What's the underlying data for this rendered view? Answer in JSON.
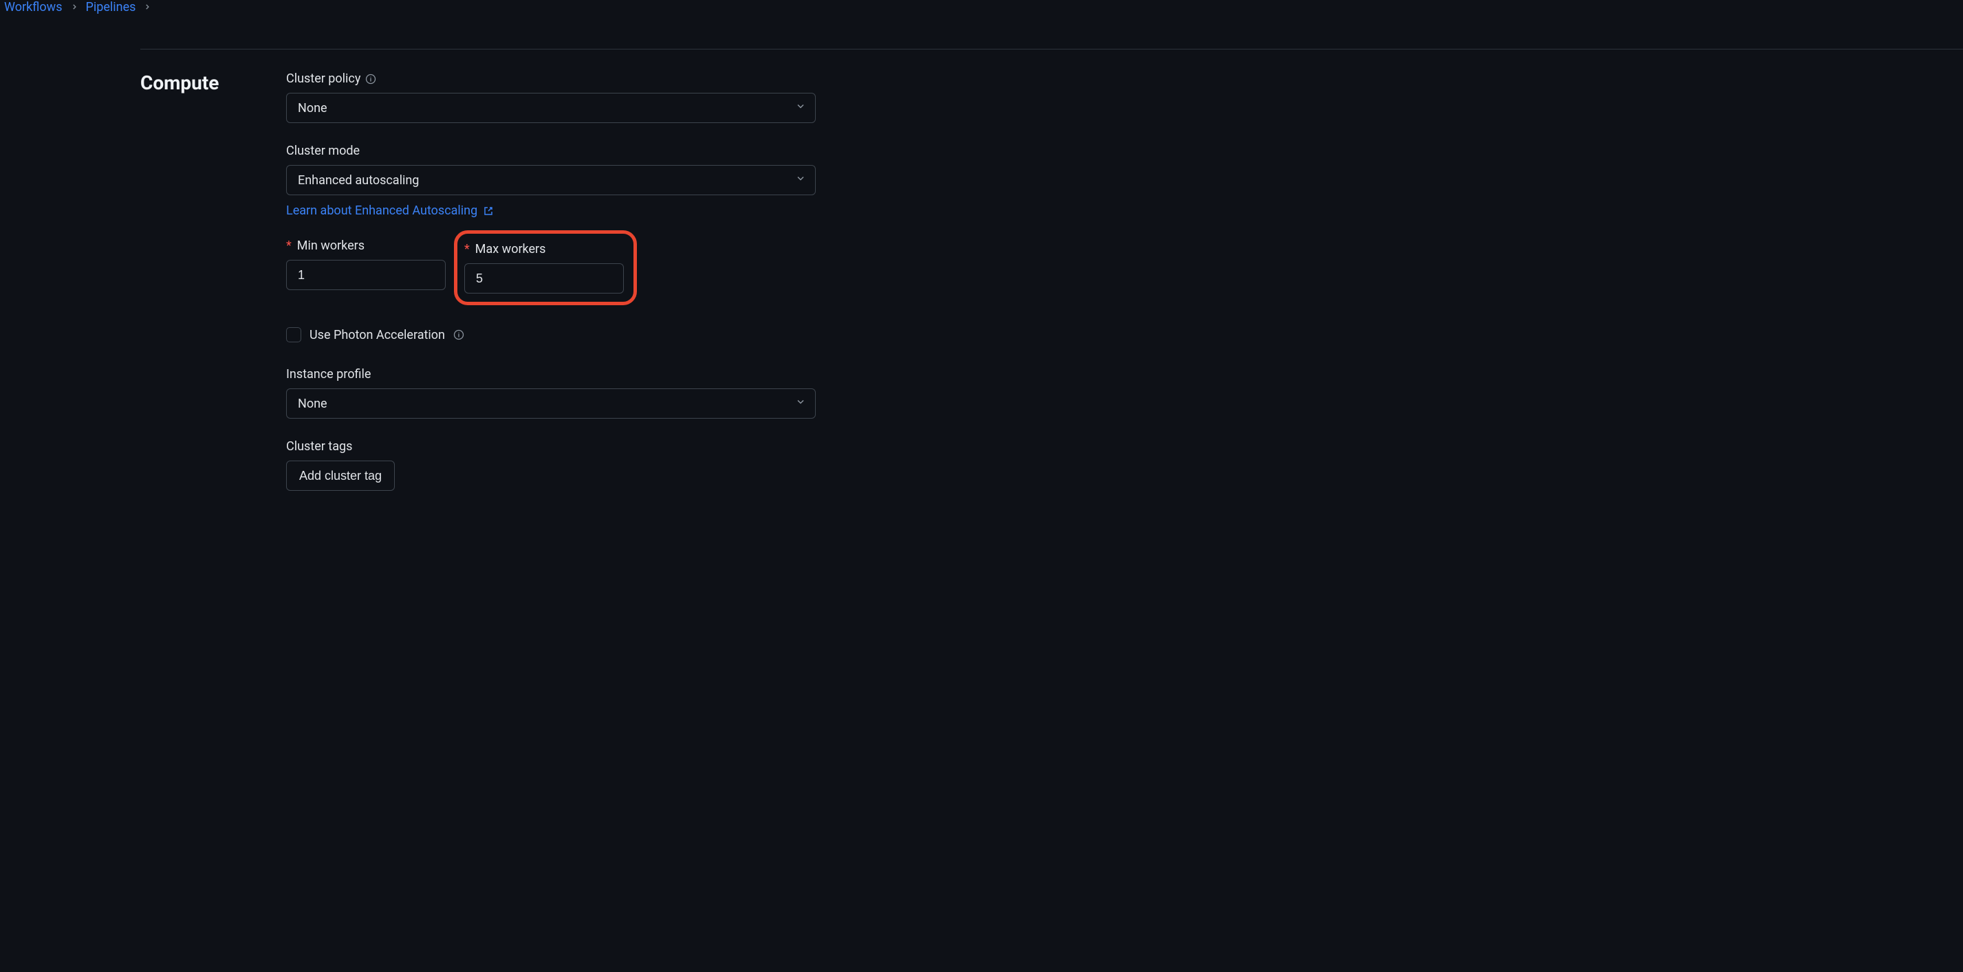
{
  "breadcrumbs": {
    "item1": "Workflows",
    "item2": "Pipelines"
  },
  "section_title": "Compute",
  "cluster_policy": {
    "label": "Cluster policy",
    "value": "None"
  },
  "cluster_mode": {
    "label": "Cluster mode",
    "value": "Enhanced autoscaling",
    "help_link": "Learn about Enhanced Autoscaling"
  },
  "min_workers": {
    "label": "Min workers",
    "value": "1"
  },
  "max_workers": {
    "label": "Max workers",
    "value": "5"
  },
  "photon": {
    "label": "Use Photon Acceleration"
  },
  "instance_profile": {
    "label": "Instance profile",
    "value": "None"
  },
  "cluster_tags": {
    "label": "Cluster tags",
    "button": "Add cluster tag"
  }
}
